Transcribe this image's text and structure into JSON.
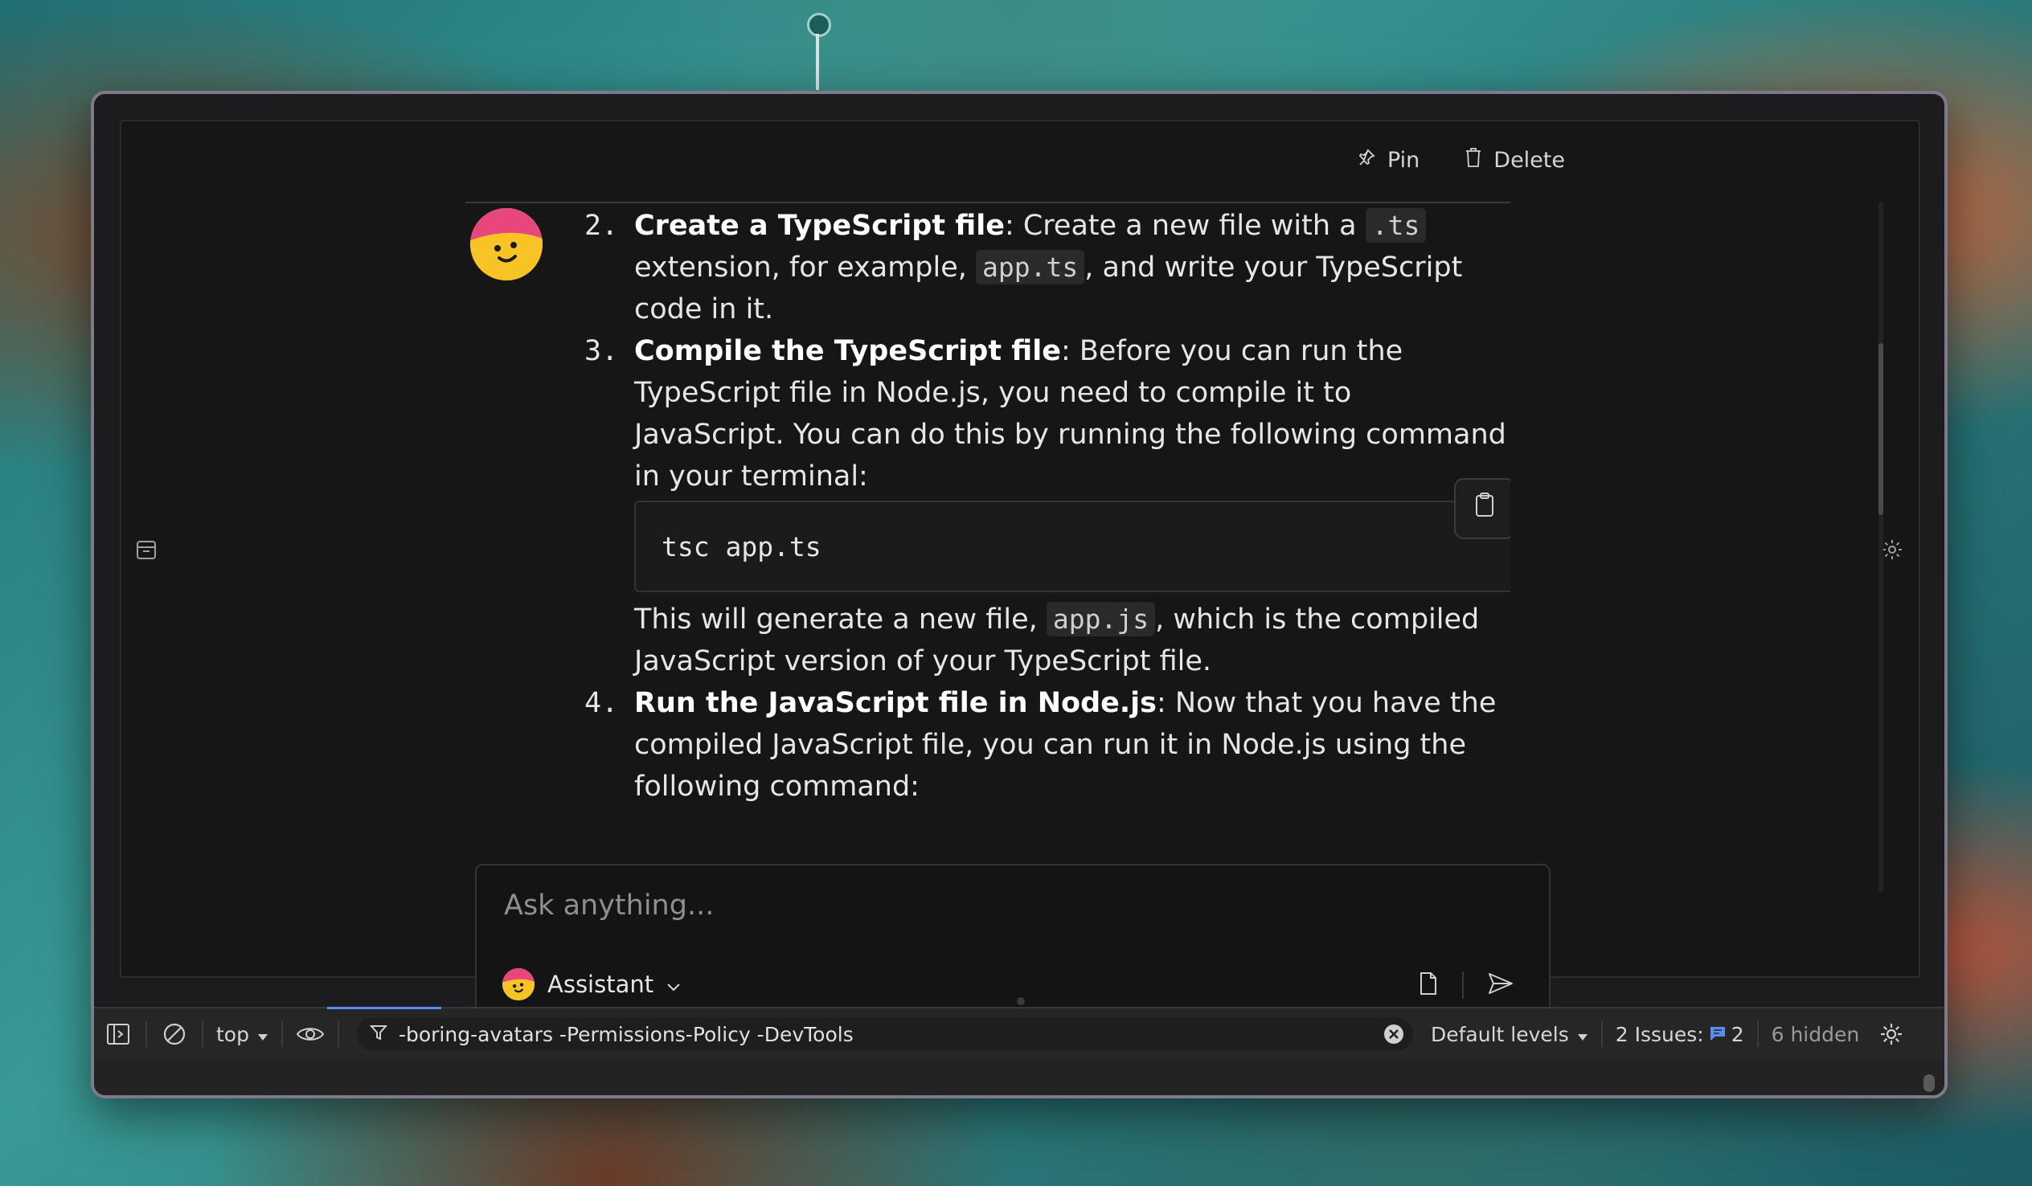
{
  "header_actions": {
    "pin": "Pin",
    "delete": "Delete"
  },
  "message": {
    "item2": {
      "num": "2.",
      "title": "Create a TypeScript file",
      "text_a": ": Create a new file with a ",
      "code_ext": ".ts",
      "text_b": " extension, for example, ",
      "code_file": "app.ts",
      "text_c": ", and write your TypeScript code in it."
    },
    "item3": {
      "num": "3.",
      "title": "Compile the TypeScript file",
      "text_a": ": Before you can run the TypeScript file in Node.js, you need to compile it to JavaScript. You can do this by running the following command in your terminal:",
      "code_block": "tsc app.ts",
      "text_b": "This will generate a new file, ",
      "code_out": "app.js",
      "text_c": ", which is the compiled JavaScript version of your TypeScript file."
    },
    "item4": {
      "num": "4.",
      "title": "Run the JavaScript file in Node.js",
      "text_a": ": Now that you have the compiled JavaScript file, you can run it in Node.js using the following command:"
    }
  },
  "input": {
    "placeholder": "Ask anything...",
    "assistant_label": "Assistant"
  },
  "devtools": {
    "context": "top",
    "filter": "-boring-avatars -Permissions-Policy -DevTools",
    "levels": "Default levels",
    "issues_label": "2 Issues:",
    "issues_count": "2",
    "hidden": "6 hidden"
  },
  "colors": {
    "accent": "#5b8def",
    "avatar_pink": "#e8477d",
    "avatar_yellow": "#f7c325"
  }
}
